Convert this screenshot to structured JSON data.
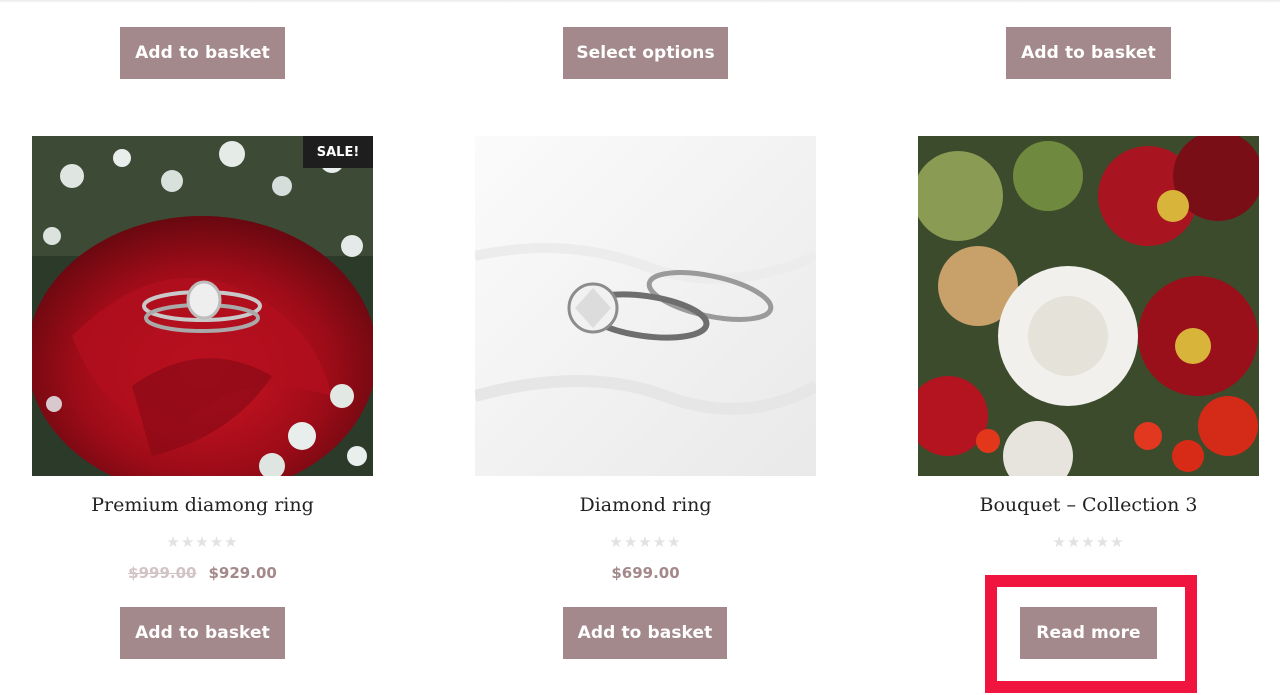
{
  "top_row": {
    "buttons": [
      "Add to basket",
      "Select options",
      "Add to basket"
    ]
  },
  "products": [
    {
      "title": "Premium diamong ring",
      "badge": "SALE!",
      "rating_stars": "★★★★★",
      "old_price": "$999.00",
      "price": "$929.00",
      "button": "Add to basket"
    },
    {
      "title": "Diamond ring",
      "rating_stars": "★★★★★",
      "price": "$699.00",
      "button": "Add to basket"
    },
    {
      "title": "Bouquet – Collection 3",
      "rating_stars": "★★★★★",
      "button": "Read more"
    }
  ],
  "colors": {
    "button_bg": "#a4898c",
    "highlight": "#f0153e"
  }
}
